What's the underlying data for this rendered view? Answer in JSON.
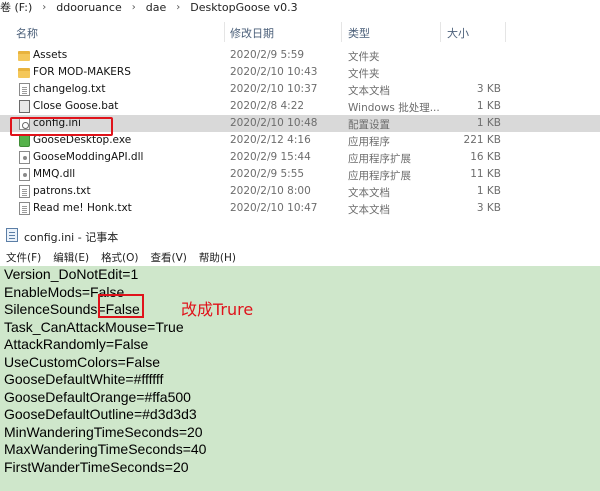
{
  "explorer": {
    "breadcrumb": [
      "卷 (F:)",
      "ddooruance",
      "dae",
      "DesktopGoose v0.3"
    ],
    "columns": {
      "name": "名称",
      "date": "修改日期",
      "type": "类型",
      "size": "大小"
    },
    "files": [
      {
        "name": "Assets",
        "date": "2020/2/9 5:59",
        "type": "文件夹",
        "size": "",
        "icon": "folder-icon",
        "selected": false
      },
      {
        "name": "FOR MOD-MAKERS",
        "date": "2020/2/10 10:43",
        "type": "文件夹",
        "size": "",
        "icon": "folder-icon",
        "selected": false
      },
      {
        "name": "changelog.txt",
        "date": "2020/2/10 10:37",
        "type": "文本文档",
        "size": "3 KB",
        "icon": "text-file-icon",
        "selected": false
      },
      {
        "name": "Close Goose.bat",
        "date": "2020/2/8 4:22",
        "type": "Windows 批处理...",
        "size": "1 KB",
        "icon": "batch-file-icon",
        "selected": false
      },
      {
        "name": "config.ini",
        "date": "2020/2/10 10:48",
        "type": "配置设置",
        "size": "1 KB",
        "icon": "settings-file-icon",
        "selected": true
      },
      {
        "name": "GooseDesktop.exe",
        "date": "2020/2/12 4:16",
        "type": "应用程序",
        "size": "221 KB",
        "icon": "app-icon",
        "selected": false
      },
      {
        "name": "GooseModdingAPI.dll",
        "date": "2020/2/9 15:44",
        "type": "应用程序扩展",
        "size": "16 KB",
        "icon": "dll-file-icon",
        "selected": false
      },
      {
        "name": "MMQ.dll",
        "date": "2020/2/9 5:55",
        "type": "应用程序扩展",
        "size": "11 KB",
        "icon": "dll-file-icon",
        "selected": false
      },
      {
        "name": "patrons.txt",
        "date": "2020/2/10 8:00",
        "type": "文本文档",
        "size": "1 KB",
        "icon": "text-file-icon",
        "selected": false
      },
      {
        "name": "Read me! Honk.txt",
        "date": "2020/2/10 10:47",
        "type": "文本文档",
        "size": "3 KB",
        "icon": "text-file-icon",
        "selected": false
      }
    ]
  },
  "notepad": {
    "title": "config.ini - 记事本",
    "menu": [
      "文件(F)",
      "编辑(E)",
      "格式(O)",
      "查看(V)",
      "帮助(H)"
    ],
    "lines": [
      "Version_DoNotEdit=1",
      "EnableMods=False",
      "SilenceSounds=False",
      "Task_CanAttackMouse=True",
      "AttackRandomly=False",
      "UseCustomColors=False",
      "GooseDefaultWhite=#ffffff",
      "GooseDefaultOrange=#ffa500",
      "GooseDefaultOutline=#d3d3d3",
      "MinWanderingTimeSeconds=20",
      "MaxWanderingTimeSeconds=40",
      "FirstWanderTimeSeconds=20"
    ],
    "annotation": "改成Trure",
    "editor_bg": "#cfe7cb",
    "highlight_color": "#e0131b"
  }
}
